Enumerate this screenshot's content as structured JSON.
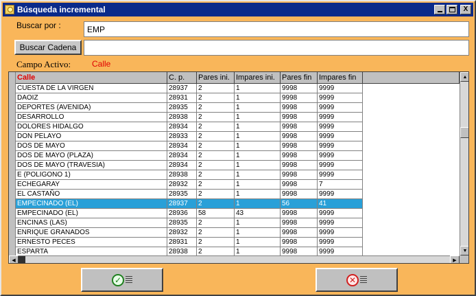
{
  "window": {
    "title": "Búsqueda incremental",
    "min_glyph": "",
    "max_glyph": "",
    "close_glyph": "X"
  },
  "search": {
    "label": "Buscar por :",
    "value": "EMP"
  },
  "search_string": {
    "button_label": "Buscar Cadena",
    "value": ""
  },
  "active_field": {
    "label": "Campo Activo:",
    "value": "Calle"
  },
  "grid": {
    "columns": [
      "Calle",
      "C. p.",
      "Pares ini.",
      "Impares ini.",
      "Pares fin",
      "Impares fin"
    ],
    "active_column": 0,
    "selected_row": 12,
    "rows": [
      [
        "CUESTA DE LA VIRGEN",
        "28937",
        "2",
        "1",
        "9998",
        "9999"
      ],
      [
        "DAOIZ",
        "28931",
        "2",
        "1",
        "9998",
        "9999"
      ],
      [
        "DEPORTES (AVENIDA)",
        "28935",
        "2",
        "1",
        "9998",
        "9999"
      ],
      [
        "DESARROLLO",
        "28938",
        "2",
        "1",
        "9998",
        "9999"
      ],
      [
        "DOLORES HIDALGO",
        "28934",
        "2",
        "1",
        "9998",
        "9999"
      ],
      [
        "DON PELAYO",
        "28933",
        "2",
        "1",
        "9998",
        "9999"
      ],
      [
        "DOS DE MAYO",
        "28934",
        "2",
        "1",
        "9998",
        "9999"
      ],
      [
        "DOS DE MAYO (PLAZA)",
        "28934",
        "2",
        "1",
        "9998",
        "9999"
      ],
      [
        "DOS DE MAYO (TRAVESIA)",
        "28934",
        "2",
        "1",
        "9998",
        "9999"
      ],
      [
        "E (POLIGONO 1)",
        "28938",
        "2",
        "1",
        "9998",
        "9999"
      ],
      [
        "ECHEGARAY",
        "28932",
        "2",
        "1",
        "9998",
        "7"
      ],
      [
        "EL CASTAÑO",
        "28935",
        "2",
        "1",
        "9998",
        "9999"
      ],
      [
        "EMPECINADO (EL)",
        "28937",
        "2",
        "1",
        "56",
        "41"
      ],
      [
        "EMPECINADO (EL)",
        "28936",
        "58",
        "43",
        "9998",
        "9999"
      ],
      [
        "ENCINAS (LAS)",
        "28935",
        "2",
        "1",
        "9998",
        "9999"
      ],
      [
        "ENRIQUE GRANADOS",
        "28932",
        "2",
        "1",
        "9998",
        "9999"
      ],
      [
        "ERNESTO PECES",
        "28931",
        "2",
        "1",
        "9998",
        "9999"
      ],
      [
        "ESPARTA",
        "28938",
        "2",
        "1",
        "9998",
        "9999"
      ]
    ]
  },
  "scroll": {
    "up_arrow": "▲",
    "down_arrow": "▼",
    "left_arrow": "◀",
    "right_arrow": "▶"
  },
  "actions": {
    "ok_icon": "check-circle-icon",
    "ok_glyph": "✓",
    "cancel_icon": "x-circle-icon",
    "cancel_glyph": "✕"
  }
}
